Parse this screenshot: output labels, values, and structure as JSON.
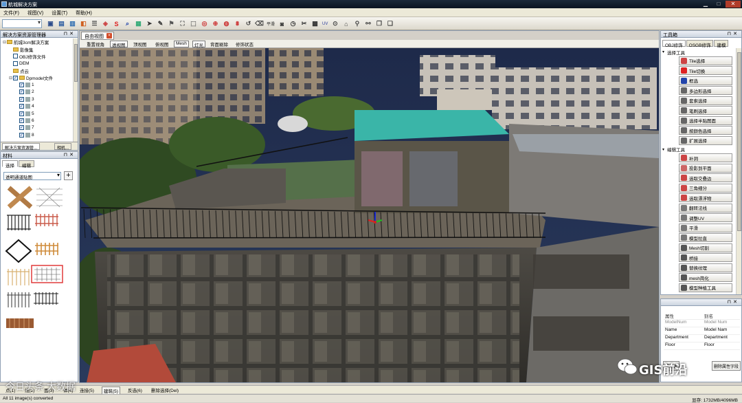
{
  "window": {
    "title": "航城解决方案"
  },
  "menu": [
    "文件(F)",
    "视图(V)",
    "设置(T)",
    "帮助(H)"
  ],
  "toolbar": {
    "tools": [
      {
        "icon": "open-icon",
        "g": "▣",
        "c": "#2a4a8a"
      },
      {
        "icon": "save-icon",
        "g": "▤",
        "c": "#2a5aa0"
      },
      {
        "icon": "layer-icon",
        "g": "▥",
        "c": "#2a6ab0"
      },
      {
        "icon": "export-icon",
        "g": "◧",
        "c": "#d06020"
      },
      {
        "icon": "list-icon",
        "g": "☰",
        "c": "#555"
      },
      {
        "icon": "tile-select-icon",
        "g": "◈",
        "c": "#c44"
      },
      {
        "icon": "tile-switch-icon",
        "g": "S",
        "c": "#d22"
      },
      {
        "icon": "zoom-icon",
        "g": "⌕",
        "c": "#24a"
      },
      {
        "icon": "tile-icon",
        "g": "▦",
        "c": "#3a7"
      },
      {
        "icon": "arrow-icon",
        "g": "➤",
        "c": "#333"
      },
      {
        "icon": "brush-icon",
        "g": "✎",
        "c": "#333"
      },
      {
        "icon": "stamp-icon",
        "g": "⚑",
        "c": "#555"
      },
      {
        "icon": "crop-icon",
        "g": "⛶",
        "c": "#555"
      },
      {
        "icon": "fill-icon",
        "g": "⬚",
        "c": "#555"
      },
      {
        "icon": "hole-icon",
        "g": "◎",
        "c": "#c33"
      },
      {
        "icon": "triangle-icon",
        "g": "⊕",
        "c": "#c33"
      },
      {
        "icon": "float-icon",
        "g": "◍",
        "c": "#c33"
      },
      {
        "icon": "grid-icon",
        "g": "⩩",
        "c": "#c33"
      },
      {
        "icon": "undo-icon",
        "g": "↺",
        "c": "#444"
      },
      {
        "icon": "eraser-icon",
        "g": "⌫",
        "c": "#444"
      },
      {
        "icon": "flatten-label",
        "t": "平滑"
      },
      {
        "icon": "camera-icon",
        "g": "◙",
        "c": "#333"
      },
      {
        "icon": "clock-icon",
        "g": "◷",
        "c": "#333"
      },
      {
        "icon": "tools-icon",
        "g": "✂",
        "c": "#333"
      },
      {
        "icon": "grid-tex-icon",
        "g": "▩",
        "c": "#333"
      },
      {
        "icon": "uv-label",
        "t": "UV",
        "c": "#2a3a9a"
      },
      {
        "icon": "target-icon",
        "g": "⊙",
        "c": "#444"
      },
      {
        "icon": "building-icon",
        "g": "⌂",
        "c": "#444"
      },
      {
        "icon": "pin-icon",
        "g": "⚲",
        "c": "#444"
      },
      {
        "icon": "tree-icon",
        "g": "⚯",
        "c": "#444"
      },
      {
        "icon": "doc-icon",
        "g": "❐",
        "c": "#444"
      },
      {
        "icon": "report-icon",
        "g": "❑",
        "c": "#444"
      }
    ]
  },
  "solution_panel": {
    "title": "解决方案资源管理器",
    "tree": [
      {
        "level": 0,
        "exp": "▬",
        "type": "folder",
        "label": "航城3cm解决方案"
      },
      {
        "level": 1,
        "exp": "",
        "type": "folder",
        "label": "影像集"
      },
      {
        "level": 1,
        "exp": "",
        "type": "cb",
        "label": "OBJ修饰文件"
      },
      {
        "level": 1,
        "exp": "",
        "type": "cb",
        "label": "DEM"
      },
      {
        "level": 1,
        "exp": "",
        "type": "folder",
        "label": "点云"
      },
      {
        "level": 1,
        "exp": "▬",
        "type": "cbc",
        "label": "Dpmodel文件"
      },
      {
        "level": 2,
        "exp": "",
        "type": "cbl",
        "label": "1"
      },
      {
        "level": 2,
        "exp": "",
        "type": "cbl",
        "label": "2"
      },
      {
        "level": 2,
        "exp": "",
        "type": "cbl",
        "label": "3"
      },
      {
        "level": 2,
        "exp": "",
        "type": "cbl",
        "label": "4"
      },
      {
        "level": 2,
        "exp": "",
        "type": "cbl",
        "label": "5"
      },
      {
        "level": 2,
        "exp": "",
        "type": "cbl",
        "label": "6"
      },
      {
        "level": 2,
        "exp": "",
        "type": "cbl",
        "label": "7"
      },
      {
        "level": 2,
        "exp": "",
        "type": "cbl",
        "label": "8"
      }
    ],
    "bottom_tabs": [
      "解决方案资源管...",
      "相机..."
    ]
  },
  "material_panel": {
    "title": "材料",
    "tabs": [
      "选择",
      "编辑"
    ],
    "combo_value": "透明通道贴图",
    "add_button": "+"
  },
  "viewport": {
    "tab_label": "自由视图",
    "close": "×",
    "buttons": [
      "重置视角",
      "透视图",
      "顶视图",
      "俯视图",
      "Mesh",
      "灯光",
      "背面剔除",
      "修饰状态"
    ],
    "active_buttons": [
      "透视图",
      "Mesh",
      "灯光"
    ]
  },
  "toolbox": {
    "title": "工具箱",
    "tabs": [
      "OBJ修饰",
      "OSGB修饰",
      "建模"
    ],
    "groups": [
      {
        "label": "选择工具",
        "tools": [
          {
            "label": "Tile选择",
            "icon": "tile-select-icon",
            "c": "#c44"
          },
          {
            "label": "Tile切换",
            "icon": "tile-switch-icon",
            "c": "#d22"
          },
          {
            "label": "框选",
            "icon": "box-select-icon",
            "c": "#24a"
          },
          {
            "label": "多边形选择",
            "icon": "polygon-select-icon",
            "c": "#666"
          },
          {
            "label": "套索选择",
            "icon": "lasso-select-icon",
            "c": "#666"
          },
          {
            "label": "笔刷选择",
            "icon": "brush-select-icon",
            "c": "#666"
          },
          {
            "label": "选择半贴图面",
            "icon": "half-face-icon",
            "c": "#666"
          },
          {
            "label": "按颜色选择",
            "icon": "color-select-icon",
            "c": "#666"
          },
          {
            "label": "扩展选择",
            "icon": "expand-select-icon",
            "c": "#666"
          }
        ]
      },
      {
        "label": "编辑工具",
        "tools": [
          {
            "label": "补洞",
            "icon": "fill-hole-icon",
            "c": "#c44"
          },
          {
            "label": "投影到平面",
            "icon": "project-plane-icon",
            "c": "#c66"
          },
          {
            "label": "选取交叠边",
            "icon": "overlap-edge-icon",
            "c": "#c44"
          },
          {
            "label": "三角细分",
            "icon": "subdivide-icon",
            "c": "#c44"
          },
          {
            "label": "选取漂浮物",
            "icon": "float-select-icon",
            "c": "#c44"
          },
          {
            "label": "翻转法线",
            "icon": "flip-normal-icon",
            "c": "#777"
          },
          {
            "label": "调整UV",
            "icon": "adjust-uv-icon",
            "c": "#777"
          },
          {
            "label": "平滑",
            "icon": "smooth-icon",
            "c": "#777"
          },
          {
            "label": "模型拉直",
            "icon": "straighten-icon",
            "c": "#777"
          },
          {
            "label": "Mesh切割",
            "icon": "mesh-cut-icon",
            "c": "#555"
          },
          {
            "label": "桥接",
            "icon": "bridge-icon",
            "c": "#555"
          },
          {
            "label": "替换纹理",
            "icon": "replace-texture-icon",
            "c": "#555"
          },
          {
            "label": "mesh简化",
            "icon": "mesh-simplify-icon",
            "c": "#555"
          },
          {
            "label": "模型种植工具",
            "icon": "plant-tool-icon",
            "c": "#555"
          }
        ]
      }
    ]
  },
  "properties": {
    "headers": [
      "属性",
      "别名"
    ],
    "rows": [
      [
        "ModelNum",
        "Model Num"
      ],
      [
        "Name",
        "Model Nam"
      ],
      [
        "Department",
        "Department"
      ],
      [
        "Floor",
        "Floor"
      ]
    ],
    "buttons": [
      "属性表",
      "删除属性字段"
    ]
  },
  "selection_bar": {
    "items": [
      "点(1)",
      "线(2)",
      "面(3)",
      "体(4)",
      "连接(5)",
      "建筑(5)",
      "反选(6)",
      "删除选择(Del)"
    ]
  },
  "status": {
    "left": "All 11 image(s) converted",
    "right": "显存: 1732MB/4096MB"
  },
  "watermark": {
    "text": "GIS前沿",
    "left_text": "今日头条 大数据"
  }
}
